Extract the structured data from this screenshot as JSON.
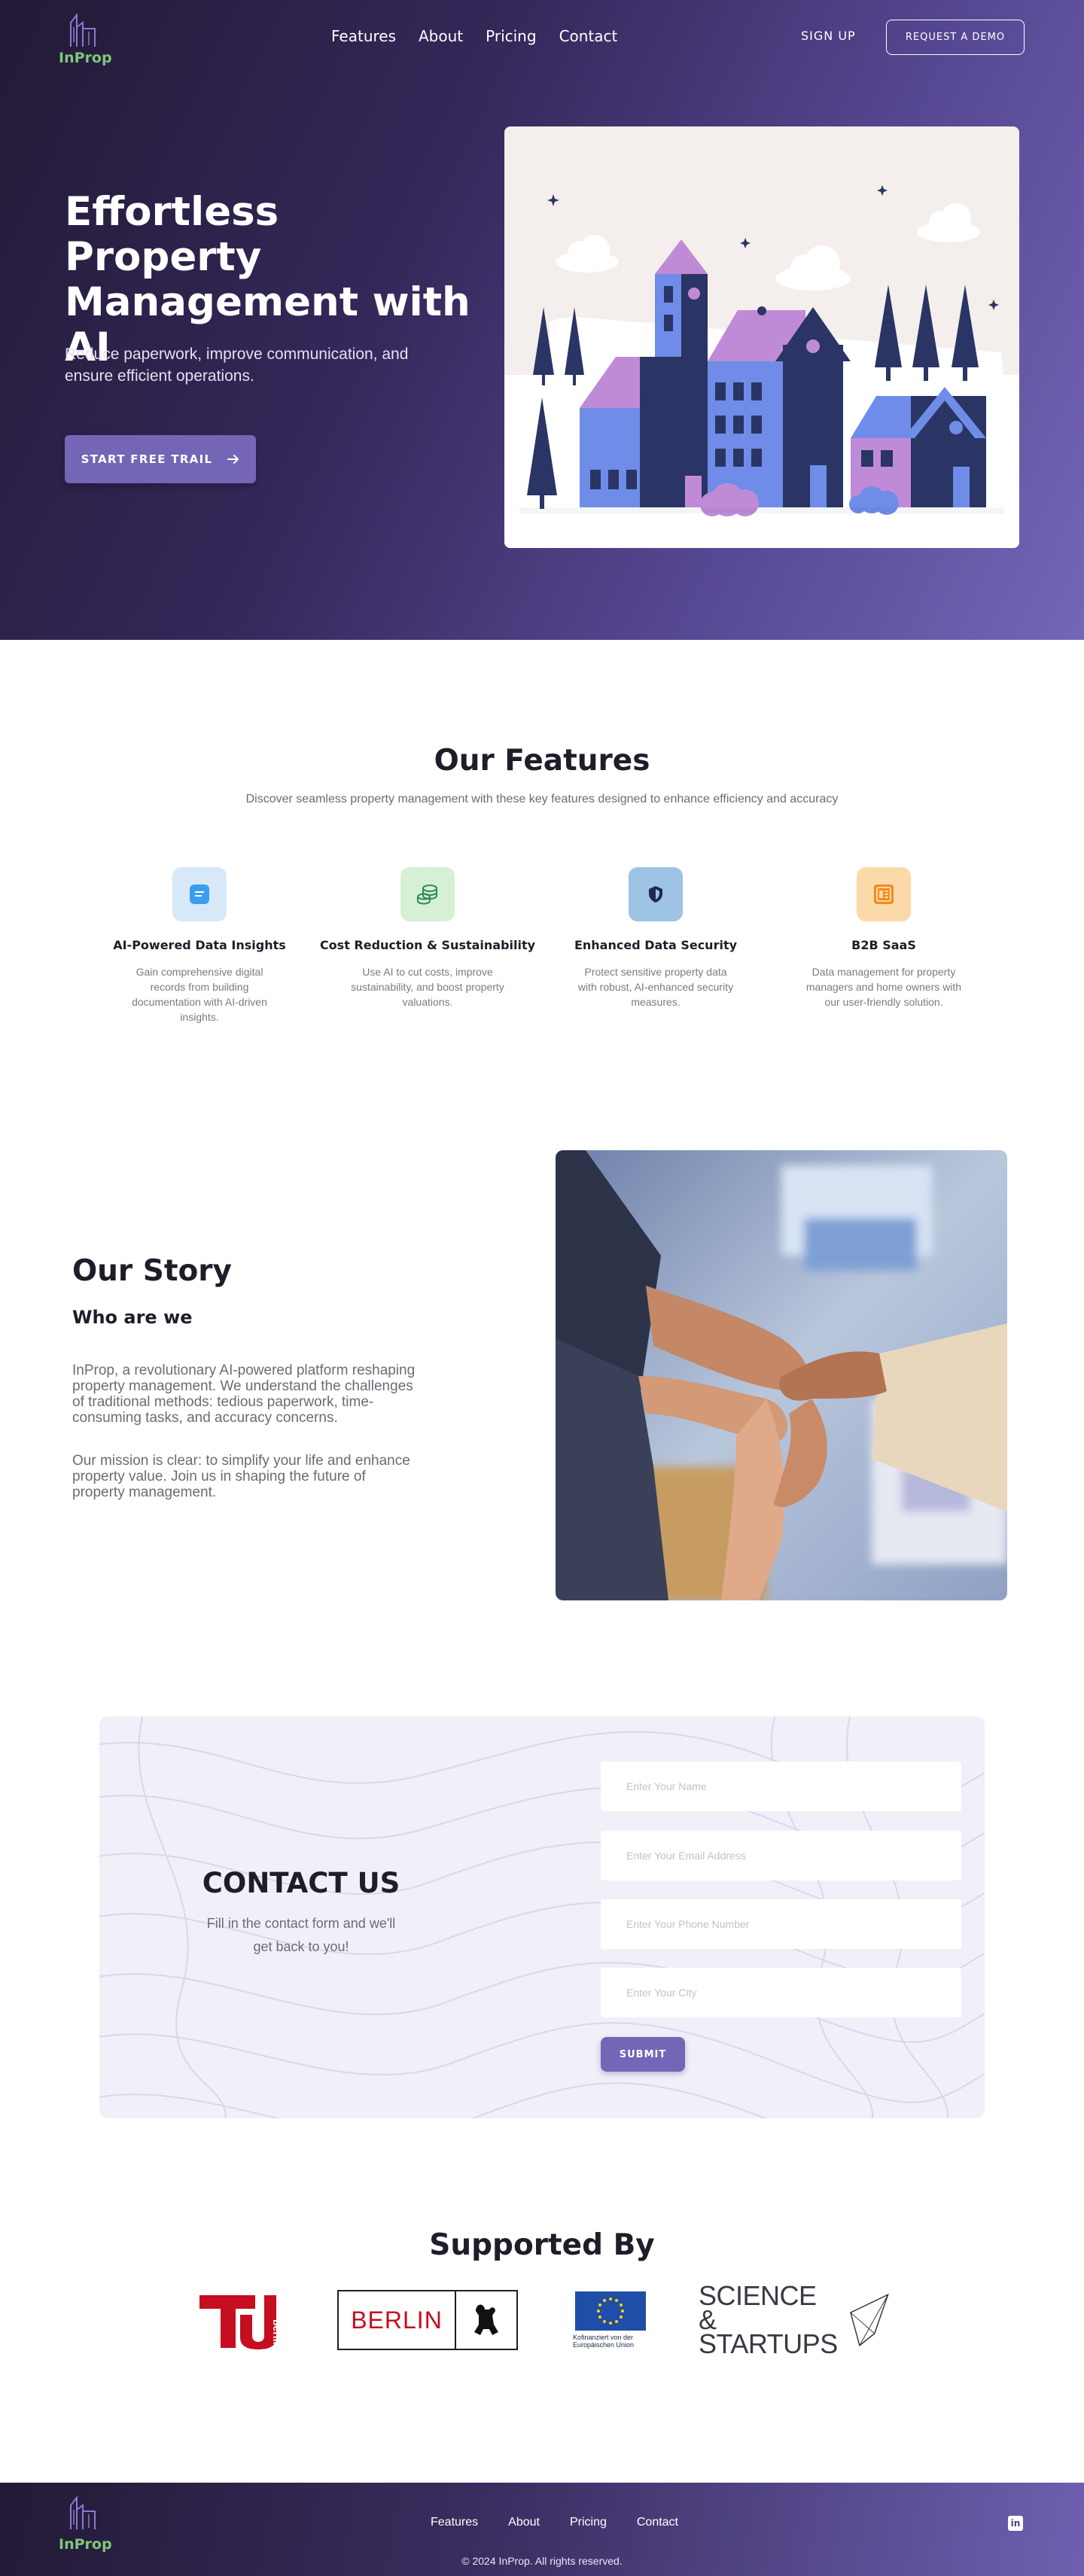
{
  "brand": {
    "name": "InProp"
  },
  "nav": {
    "items": [
      "Features",
      "About",
      "Pricing",
      "Contact"
    ],
    "signup": "SIGN UP",
    "demo": "REQUEST A DEMO"
  },
  "hero": {
    "title": "Effortless Property Management with AI",
    "subtitle": "Reduce paperwork, improve communication, and ensure efficient operations.",
    "cta": "START FREE TRAIL"
  },
  "features": {
    "title": "Our Features",
    "subtitle": "Discover seamless property management with these key features designed to enhance efficiency and accuracy",
    "items": [
      {
        "title": "AI-Powered Data Insights",
        "desc": "Gain comprehensive digital records from building documentation with AI-driven insights.",
        "icon": "chat-icon",
        "bg": "#d7e9f8",
        "color": "#3b9df0"
      },
      {
        "title": "Cost Reduction & Sustainability",
        "desc": "Use AI to cut costs, improve sustainability, and boost property valuations.",
        "icon": "coins-icon",
        "bg": "#d6f0d6",
        "color": "#2e8b57"
      },
      {
        "title": "Enhanced Data Security",
        "desc": "Protect sensitive property data with robust, AI-enhanced security measures.",
        "icon": "shield-icon",
        "bg": "#9ec3e4",
        "color": "#1e2a4a"
      },
      {
        "title": "B2B SaaS",
        "desc": "Data management for property managers and home owners with our user-friendly solution.",
        "icon": "document-icon",
        "bg": "#fcd9a8",
        "color": "#f08c1e"
      }
    ]
  },
  "story": {
    "title": "Our Story",
    "subtitle": "Who are we",
    "p1": "InProp, a revolutionary AI-powered platform reshaping property management. We understand the challenges of traditional methods: tedious paperwork, time-consuming tasks, and accuracy concerns.",
    "p2": "Our mission is clear: to simplify your life and enhance property value. Join us in shaping the future of property management."
  },
  "contact": {
    "title": "CONTACT US",
    "subtitle": "Fill in the contact form and we'll get back to you!",
    "fields": [
      "Enter Your Name",
      "Enter Your Email Address",
      "Enter Your Phone Number",
      "Enter Your City"
    ],
    "submit": "SUBMIT"
  },
  "supported": {
    "title": "Supported By",
    "berlin": "BERLIN",
    "tu_berlin": "berlin",
    "eu_caption": "Kofinanziert von der Europäischen Union",
    "science": "SCIENCE &",
    "startups": "STARTUPS"
  },
  "footer": {
    "nav": [
      "Features",
      "About",
      "Pricing",
      "Contact"
    ],
    "copyright": "© 2024 InProp. All rights reserved.",
    "linkedin": "in"
  },
  "colors": {
    "accent": "#7565b6",
    "dark": "#221a36",
    "brand_green": "#7ec876"
  }
}
